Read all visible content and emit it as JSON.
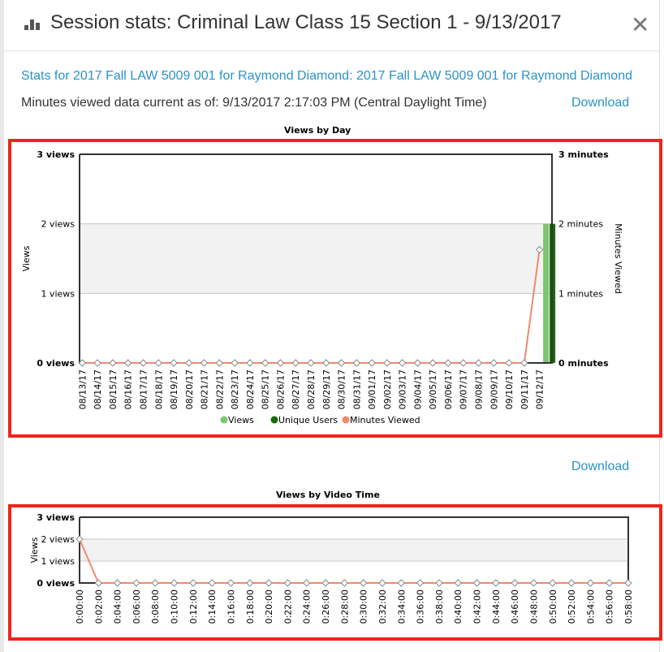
{
  "header": {
    "icon": "bar-chart-icon",
    "title": "Session stats: Criminal Law Class 15 Section 1 - 9/13/2017",
    "close_icon": "close-icon",
    "close_glyph": "✕"
  },
  "info": {
    "stats_link": "Stats for 2017 Fall LAW 5009 001 for Raymond Diamond: 2017 Fall LAW 5009 001 for Raymond Diamond",
    "as_of": "Minutes viewed data current as of: 9/13/2017 2:17:03 PM (Central Daylight Time)",
    "download_label": "Download"
  },
  "colors": {
    "link": "#2a93c9",
    "frame": "#f0241a",
    "views": "#7dc571",
    "unique_users": "#1a6b0a",
    "minutes": "#f08a6a",
    "band": "#f2f2f2"
  },
  "chart_data": [
    {
      "type": "bar",
      "title": "Views by Day",
      "xlabel": "",
      "ylabel": "Views",
      "y2label": "Minutes Viewed",
      "ylim": [
        0,
        3
      ],
      "y2lim": [
        0,
        3
      ],
      "yticks": [
        "0 views",
        "1 views",
        "2 views",
        "3 views"
      ],
      "y2ticks": [
        "0 minutes",
        "1 minutes",
        "2 minutes",
        "3 minutes"
      ],
      "grid": true,
      "legend": "bottom",
      "categories": [
        "08/13/17",
        "08/14/17",
        "08/15/17",
        "08/16/17",
        "08/17/17",
        "08/18/17",
        "08/19/17",
        "08/20/17",
        "08/21/17",
        "08/22/17",
        "08/23/17",
        "08/24/17",
        "08/25/17",
        "08/26/17",
        "08/27/17",
        "08/28/17",
        "08/29/17",
        "08/30/17",
        "08/31/17",
        "09/01/17",
        "09/02/17",
        "09/03/17",
        "09/04/17",
        "09/05/17",
        "09/06/17",
        "09/07/17",
        "09/08/17",
        "09/09/17",
        "09/10/17",
        "09/11/17",
        "09/12/17"
      ],
      "series": [
        {
          "name": "Views",
          "kind": "bar",
          "values": [
            0,
            0,
            0,
            0,
            0,
            0,
            0,
            0,
            0,
            0,
            0,
            0,
            0,
            0,
            0,
            0,
            0,
            0,
            0,
            0,
            0,
            0,
            0,
            0,
            0,
            0,
            0,
            0,
            0,
            0,
            2
          ]
        },
        {
          "name": "Unique Users",
          "kind": "bar",
          "values": [
            0,
            0,
            0,
            0,
            0,
            0,
            0,
            0,
            0,
            0,
            0,
            0,
            0,
            0,
            0,
            0,
            0,
            0,
            0,
            0,
            0,
            0,
            0,
            0,
            0,
            0,
            0,
            0,
            0,
            0,
            2
          ]
        },
        {
          "name": "Minutes Viewed",
          "kind": "line",
          "axis": "right",
          "values": [
            0,
            0,
            0,
            0,
            0,
            0,
            0,
            0,
            0,
            0,
            0,
            0,
            0,
            0,
            0,
            0,
            0,
            0,
            0,
            0,
            0,
            0,
            0,
            0,
            0,
            0,
            0,
            0,
            0,
            0,
            1.63
          ]
        }
      ]
    },
    {
      "type": "line",
      "title": "Views by Video Time",
      "xlabel": "",
      "ylabel": "Views",
      "ylim": [
        0,
        3
      ],
      "yticks": [
        "0 views",
        "1 views",
        "2 views",
        "3 views"
      ],
      "grid": true,
      "categories": [
        "0:00:00",
        "0:02:00",
        "0:04:00",
        "0:06:00",
        "0:08:00",
        "0:10:00",
        "0:12:00",
        "0:14:00",
        "0:16:00",
        "0:18:00",
        "0:20:00",
        "0:22:00",
        "0:24:00",
        "0:26:00",
        "0:28:00",
        "0:30:00",
        "0:32:00",
        "0:34:00",
        "0:36:00",
        "0:38:00",
        "0:40:00",
        "0:42:00",
        "0:44:00",
        "0:46:00",
        "0:48:00",
        "0:50:00",
        "0:52:00",
        "0:54:00",
        "0:56:00",
        "0:58:00"
      ],
      "series": [
        {
          "name": "Views",
          "values": [
            2,
            0,
            0,
            0,
            0,
            0,
            0,
            0,
            0,
            0,
            0,
            0,
            0,
            0,
            0,
            0,
            0,
            0,
            0,
            0,
            0,
            0,
            0,
            0,
            0,
            0,
            0,
            0,
            0,
            0
          ]
        }
      ]
    }
  ]
}
